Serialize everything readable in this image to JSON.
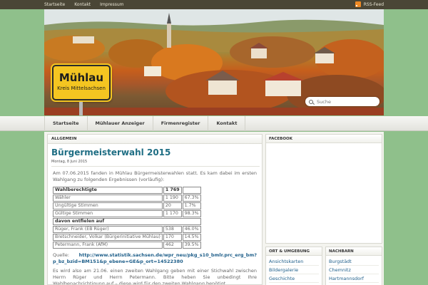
{
  "topbar": {
    "links": [
      "Startseite",
      "Kontakt",
      "Impressum"
    ],
    "rss_label": "RSS-Feed"
  },
  "header": {
    "sign_title": "Mühlau",
    "sign_subtitle": "Kreis Mittelsachsen",
    "search_placeholder": "Suche"
  },
  "nav": [
    "Startseite",
    "Mühlauer Anzeiger",
    "Firmenregister",
    "Kontakt"
  ],
  "category": "ALLGEMEIN",
  "post": {
    "title": "Bürgermeisterwahl 2015",
    "date": "Montag, 8 Juni 2015",
    "intro": "Am 07.06.2015 fanden in Mühlau Bürgermeisterwahlen statt. Es kam dabei im ersten Wahlgang zu folgenden Ergebnissen (vorläufig):",
    "table": [
      {
        "label": "Wahlberechtigte",
        "count": "1 769",
        "pct": "",
        "bold": true
      },
      {
        "label": "Wähler",
        "count": "1 190",
        "pct": "67.3%",
        "bold": false
      },
      {
        "label": "Ungültige Stimmen",
        "count": "20",
        "pct": "1.7%",
        "bold": false
      },
      {
        "label": "Gültige Stimmen",
        "count": "1 170",
        "pct": "98.3%",
        "bold": false
      },
      {
        "label": "davon entfielen auf",
        "count": "",
        "pct": "",
        "bold": true,
        "span": true
      },
      {
        "label": "Rüger, Frank (EB Rüger)",
        "count": "538",
        "pct": "46.0%",
        "bold": false
      },
      {
        "label": "Bretschneider, Volkar (Bürgerinitiative Mühlau)",
        "count": "170",
        "pct": "14.5%",
        "bold": false
      },
      {
        "label": "Petermann, Frank (AfM)",
        "count": "462",
        "pct": "39.5%",
        "bold": false
      }
    ],
    "source_label": "Quelle:",
    "source_url": "http://www.statistik.sachsen.de/wpr_neu/pkg_s10_bmlr.prc_erg_bm?p_bz_bzid=BM151&p_ebene=GE&p_ort=14522380",
    "outro": "Es wird also am 21.06. einen zweiten Wahlgang geben mit einer Stichwahl zwischen Herrn Rüger und Herrn Petermann. Bitte heben Sie unbedingt Ihre Wahlbenachrichtigung auf – diese wird für den zweiten Wahlgang benötigt."
  },
  "sidebar": {
    "facebook_title": "FACEBOOK",
    "orte_title": "ORT & UMGEBUNG",
    "orte": [
      "Ansichtskarten",
      "Bildergalerie",
      "Geschichte"
    ],
    "nachbarn_title": "NACHBARN",
    "nachbarn": [
      "Burgstädt",
      "Chemnitz",
      "Hartmannsdorf"
    ]
  },
  "colors": {
    "background": "#8fc08b",
    "topbar": "#4a4636",
    "title": "#1f6e84",
    "link": "#1f5f8a",
    "sign": "#f4c521",
    "rss": "#f08a24"
  }
}
